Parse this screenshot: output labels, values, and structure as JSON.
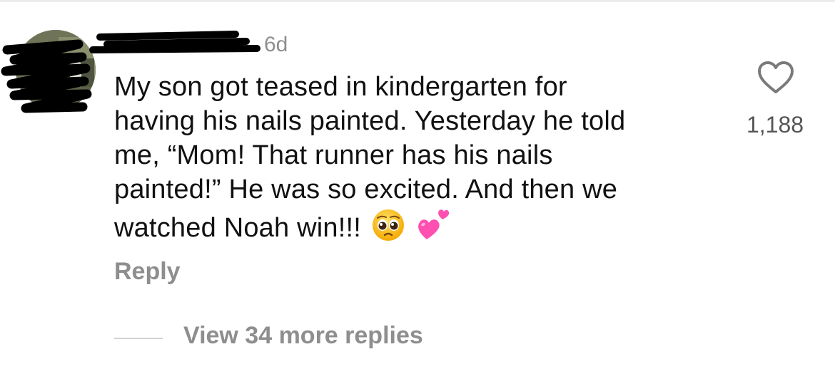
{
  "comment": {
    "timestamp": "6d",
    "lines": [
      "My son got teased in kindergarten for",
      "having his nails painted. Yesterday he told",
      "me, “Mom! That runner has his nails",
      "painted!” He was so excited. And then we",
      "watched Noah win!!!"
    ],
    "emojis": [
      "pleading-face-emoji",
      "two-hearts-emoji"
    ],
    "like_count": "1,188",
    "reply_label": "Reply",
    "view_replies_label": "View 34 more replies"
  },
  "colors": {
    "meta_gray": "#8e8e8e",
    "count_gray": "#555555",
    "text": "#111111",
    "heart_outline": "#7a7a7a",
    "emoji_heart": "#ff4fb0"
  },
  "icons": {
    "like": "heart-outline-icon"
  }
}
